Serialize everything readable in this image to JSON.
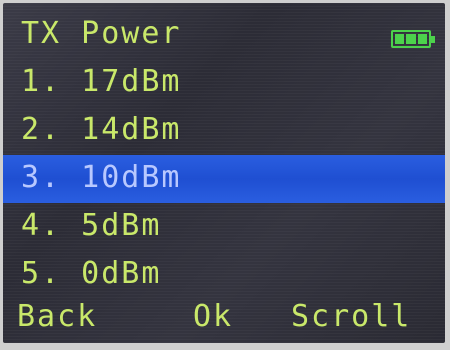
{
  "header": {
    "title": "TX Power"
  },
  "status": {
    "battery_icon": "battery-full-icon",
    "battery_color": "#4cd24c"
  },
  "menu": {
    "selected_index": 2,
    "items": [
      {
        "label": "1. 17dBm"
      },
      {
        "label": "2. 14dBm"
      },
      {
        "label": "3. 10dBm"
      },
      {
        "label": "4. 5dBm"
      },
      {
        "label": "5. 0dBm"
      }
    ]
  },
  "softkeys": {
    "back": "Back",
    "ok": "Ok",
    "scroll": "Scroll"
  },
  "colors": {
    "text": "#c9e86a",
    "highlight": "#1f4fd2",
    "background": "#2f2f3a"
  }
}
